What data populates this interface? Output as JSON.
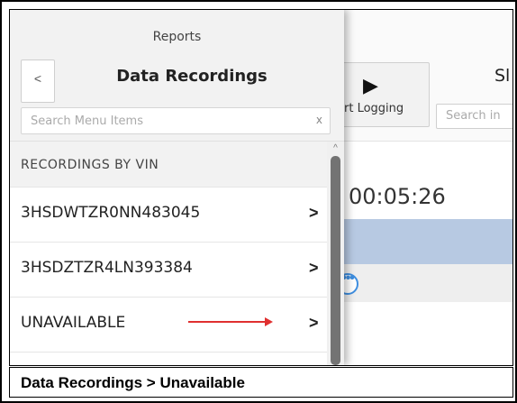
{
  "app": {
    "toolbar_button_label": "rt Logging",
    "toolbar_letter": "Sl",
    "toolbar_search_placeholder": "Search in",
    "timer": "00:05:26"
  },
  "drawer": {
    "breadcrumb": "Reports",
    "back_label": "<",
    "title": "Data Recordings",
    "search_placeholder": "Search Menu Items",
    "search_clear": "x",
    "section_header": "RECORDINGS BY VIN",
    "items": [
      {
        "label": "3HSDWTZR0NN483045",
        "chevron": ">"
      },
      {
        "label": "3HSDZTZR4LN393384",
        "chevron": ">"
      },
      {
        "label": "UNAVAILABLE",
        "chevron": ">"
      }
    ]
  },
  "caption": "Data Recordings > Unavailable",
  "colors": {
    "annotation_arrow": "#e03030",
    "selected_band": "#b7c9e2",
    "more_icon": "#3e8ee0"
  }
}
